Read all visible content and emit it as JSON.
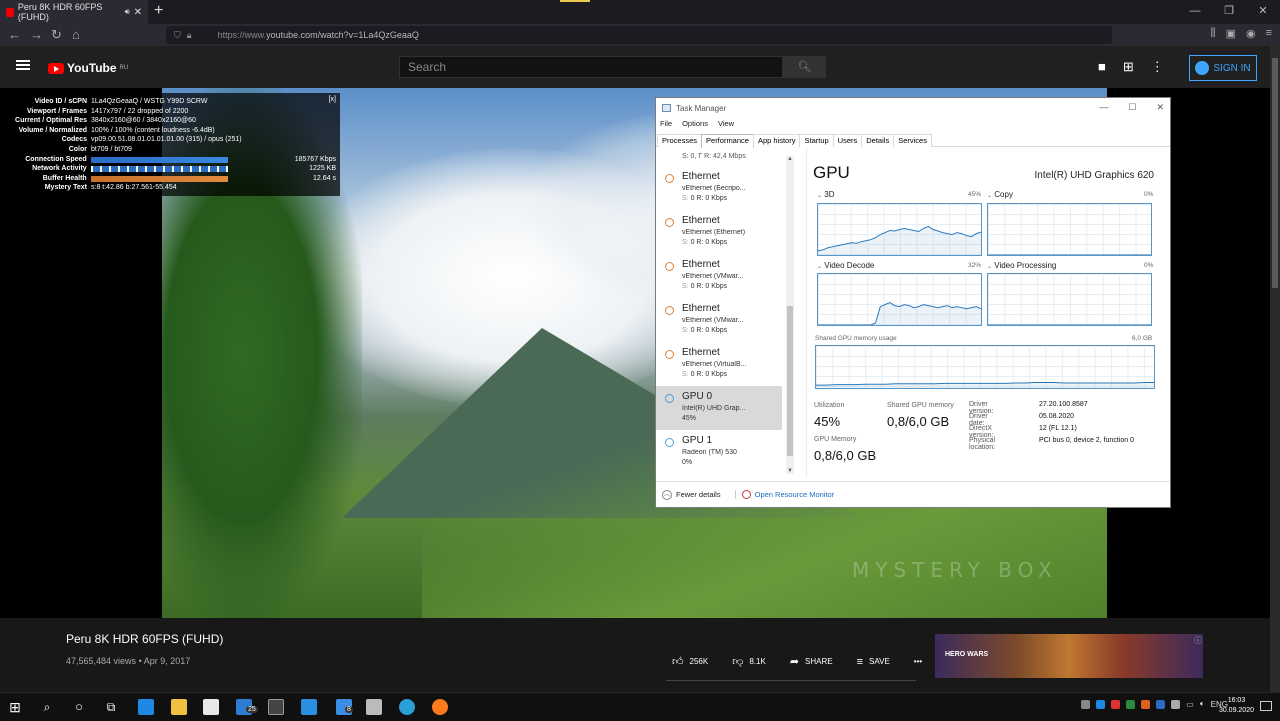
{
  "browser": {
    "tab_title": "Peru 8K HDR 60FPS (FUHD)",
    "tab_audio_icon": "speaker-icon",
    "tab_close": "✕",
    "new_tab": "+",
    "url_prefix": "https://www.",
    "url": "youtube.com/watch?v=1La4QzGeaaQ",
    "window_controls": [
      "—",
      "❐",
      "✕"
    ]
  },
  "youtube": {
    "logo_text": "YouTube",
    "logo_region": "RU",
    "search_placeholder": "Search",
    "signin_label": "SIGN IN",
    "video_title": "Peru 8K HDR 60FPS (FUHD)",
    "views": "47,565,484 views",
    "date": "Apr 9, 2017",
    "likes": "256K",
    "dislikes": "8.1K",
    "share_label": "SHARE",
    "save_label": "SAVE",
    "more_label": "•••",
    "watermark": "MYSTERY BOX",
    "ad_text": "HERO WARS"
  },
  "stats": {
    "close": "[x]",
    "rows": [
      {
        "k": "Video ID / sCPN",
        "v": "1La4QzGeaaQ / WSTG Y99D SCRW"
      },
      {
        "k": "Viewport / Frames",
        "v": "1417x797 / 22 dropped of 2200"
      },
      {
        "k": "Current / Optimal Res",
        "v": "3840x2160@60 / 3840x2160@60"
      },
      {
        "k": "Volume / Normalized",
        "v": "100% / 100% (content loudness -6.4dB)"
      },
      {
        "k": "Codecs",
        "v": "vp09.00.51.08.01.01.01.01.00 (315) / opus (251)"
      },
      {
        "k": "Color",
        "v": "bt709 / bt709"
      },
      {
        "k": "Connection Speed",
        "bar": "blue",
        "extra": "185767 Kbps"
      },
      {
        "k": "Network Activity",
        "bar": "net",
        "extra": "1225 KB"
      },
      {
        "k": "Buffer Health",
        "bar": "buf",
        "extra": "12.64 s"
      },
      {
        "k": "Mystery Text",
        "v": "s:8 t:42.86 b:27.561-55.454"
      }
    ]
  },
  "taskmanager": {
    "title": "Task Manager",
    "menu": [
      "File",
      "Options",
      "View"
    ],
    "tabs": [
      "Processes",
      "Performance",
      "App history",
      "Startup",
      "Users",
      "Details",
      "Services"
    ],
    "active_tab": "Performance",
    "sidebar_clip": "S: 0, Г R: 42,4 Mbps",
    "sidebar": [
      {
        "name": "Ethernet",
        "sub": "vEthernet (Беспро...",
        "s": "S:",
        "r": "0 R: 0 Kbps",
        "color": "orange"
      },
      {
        "name": "Ethernet",
        "sub": "vEthernet (Ethernet)",
        "s": "S:",
        "r": "0 R: 0 Kbps",
        "color": "orange"
      },
      {
        "name": "Ethernet",
        "sub": "vEthernet (VMwar...",
        "s": "S:",
        "r": "0 R: 0 Kbps",
        "color": "orange"
      },
      {
        "name": "Ethernet",
        "sub": "vEthernet (VMwar...",
        "s": "S:",
        "r": "0 R: 0 Kbps",
        "color": "orange"
      },
      {
        "name": "Ethernet",
        "sub": "vEthernet (VirtualB...",
        "s": "S:",
        "r": "0 R: 0 Kbps",
        "color": "orange"
      },
      {
        "name": "GPU 0",
        "sub": "Intel(R) UHD Grap...",
        "s": "",
        "r": "45%",
        "color": "blue",
        "selected": true
      },
      {
        "name": "GPU 1",
        "sub": "Radeon (TM) 530",
        "s": "",
        "r": "0%",
        "color": "blue"
      }
    ],
    "gpu_heading": "GPU",
    "gpu_model": "Intel(R) UHD Graphics 620",
    "engines": [
      {
        "label": "3D",
        "pct": "45%",
        "series": [
          8,
          10,
          14,
          16,
          18,
          20,
          22,
          24,
          23,
          26,
          28,
          30,
          34,
          40,
          44,
          48,
          47,
          50,
          52,
          50,
          48,
          46,
          52,
          56,
          50,
          47,
          44,
          42,
          40,
          44,
          42,
          38,
          36,
          42,
          45
        ]
      },
      {
        "label": "Copy",
        "pct": "0%",
        "series": [
          0,
          0,
          0,
          0,
          0,
          0,
          0,
          0,
          0,
          0,
          0,
          0,
          0,
          0,
          0,
          0,
          0,
          0,
          0,
          0,
          0,
          0,
          0,
          0,
          0,
          0,
          0,
          0,
          0,
          0,
          0,
          0,
          0,
          0,
          0
        ]
      },
      {
        "label": "Video Decode",
        "pct": "32%",
        "series": [
          0,
          0,
          0,
          0,
          0,
          0,
          0,
          0,
          0,
          0,
          0,
          0,
          4,
          36,
          40,
          44,
          38,
          36,
          40,
          38,
          34,
          36,
          40,
          38,
          36,
          34,
          36,
          38,
          34,
          36,
          34,
          32,
          34,
          36,
          32
        ]
      },
      {
        "label": "Video Processing",
        "pct": "0%",
        "series": [
          0,
          0,
          0,
          0,
          0,
          0,
          0,
          0,
          0,
          0,
          0,
          0,
          0,
          0,
          0,
          0,
          0,
          0,
          0,
          0,
          0,
          0,
          0,
          0,
          0,
          0,
          0,
          0,
          0,
          0,
          0,
          0,
          0,
          0,
          0
        ]
      }
    ],
    "shared_mem_label": "Shared GPU memory usage",
    "shared_mem_max": "6,0 GB",
    "shared_mem_series": [
      7,
      7,
      8,
      8,
      8,
      9,
      9,
      9,
      10,
      10,
      10,
      10,
      10,
      11,
      11,
      11,
      11,
      11,
      11,
      11,
      12,
      12,
      13,
      13,
      13,
      12,
      12,
      12,
      12,
      12,
      12,
      12,
      12,
      13,
      13
    ],
    "utilization_label": "Utilization",
    "utilization": "45%",
    "shared_label": "Shared GPU memory",
    "shared": "0,8/6,0 GB",
    "gpumem_label": "GPU Memory",
    "gpumem": "0,8/6,0 GB",
    "details": [
      {
        "k": "Driver version:",
        "v": "27.20.100.8587"
      },
      {
        "k": "Driver date:",
        "v": "05.08.2020"
      },
      {
        "k": "DirectX version:",
        "v": "12 (FL 12.1)"
      },
      {
        "k": "Physical location:",
        "v": "PCI bus 0, device 2, function 0"
      }
    ],
    "fewer_details": "Fewer details",
    "open_monitor": "Open Resource Monitor",
    "window_controls": [
      "—",
      "☐",
      "✕"
    ]
  },
  "taskbar": {
    "tray_lang": "ENG",
    "time": "16:03",
    "date": "30.09.2020",
    "badge_mail": "25",
    "badge_files": "8"
  }
}
